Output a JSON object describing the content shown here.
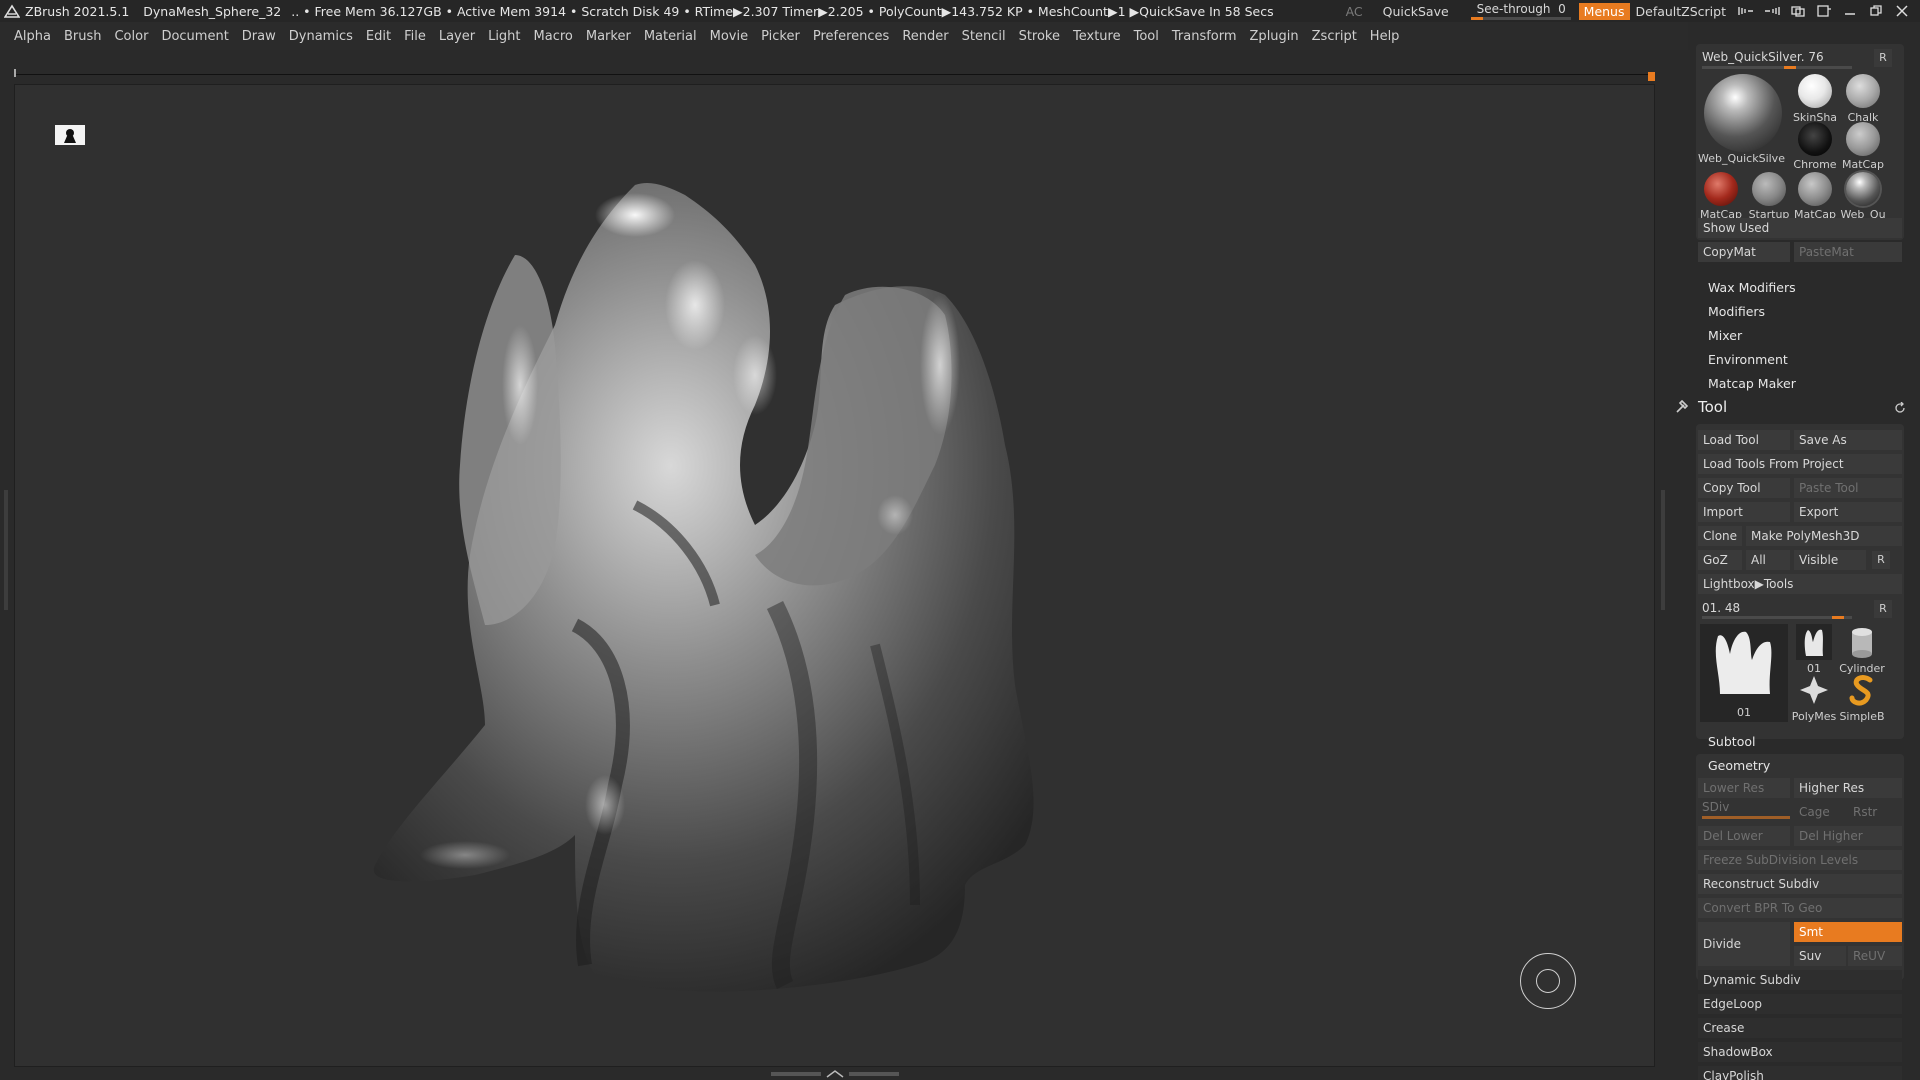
{
  "titlebar": {
    "app_title": "ZBrush 2021.5.1",
    "document": "DynaMesh_Sphere_32",
    "status": ".. • Free Mem 36.127GB • Active Mem 3914 • Scratch Disk 49 •  RTime▶2.307 Timer▶2.205 • PolyCount▶143.752 KP  • MeshCount▶1  ▶QuickSave In 58 Secs",
    "ac": "AC",
    "quicksave": "QuickSave",
    "see_through_label": "See-through",
    "see_through_value": "0",
    "menus": "Menus",
    "zscript": "DefaultZScript"
  },
  "menubar": [
    "Alpha",
    "Brush",
    "Color",
    "Document",
    "Draw",
    "Dynamics",
    "Edit",
    "File",
    "Layer",
    "Light",
    "Macro",
    "Marker",
    "Material",
    "Movie",
    "Picker",
    "Preferences",
    "Render",
    "Stencil",
    "Stroke",
    "Texture",
    "Tool",
    "Transform",
    "Zplugin",
    "Zscript",
    "Help"
  ],
  "material": {
    "current": "Web_QuickSilver. 76",
    "r": "R",
    "large_label": "Web_QuickSilver",
    "thumbs": [
      {
        "label": "SkinSha"
      },
      {
        "label": "Chalk"
      },
      {
        "label": "Chrome"
      },
      {
        "label": "MatCap"
      },
      {
        "label": "MatCap"
      },
      {
        "label": "Startup"
      },
      {
        "label": "MatCap"
      },
      {
        "label": "Web_Qu"
      }
    ],
    "show_used": "Show Used",
    "copy_mat": "CopyMat",
    "paste_mat": "PasteMat"
  },
  "sections": {
    "wax_modifiers": "Wax Modifiers",
    "modifiers": "Modifiers",
    "mixer": "Mixer",
    "environment": "Environment",
    "matcap_maker": "Matcap Maker"
  },
  "tool": {
    "title": "Tool",
    "load_tool": "Load Tool",
    "save_as": "Save As",
    "load_from_project": "Load Tools From Project",
    "copy_tool": "Copy Tool",
    "paste_tool": "Paste Tool",
    "import": "Import",
    "export": "Export",
    "clone": "Clone",
    "make_polymesh": "Make PolyMesh3D",
    "goz": "GoZ",
    "all": "All",
    "visible": "Visible",
    "r": "R",
    "lightbox": "Lightbox▶Tools",
    "slider_label": "01. 48",
    "slider_fraction": 0.94,
    "main_label": "01",
    "thumbs": [
      {
        "label": "01"
      },
      {
        "label": "Cylinder"
      },
      {
        "label": "PolyMes"
      },
      {
        "label": "SimpleB"
      }
    ]
  },
  "subtool": "Subtool",
  "geometry": {
    "title": "Geometry",
    "lower_res": "Lower Res",
    "higher_res": "Higher Res",
    "sdiv": "SDiv",
    "cage": "Cage",
    "rstr": "Rstr",
    "del_lower": "Del Lower",
    "del_higher": "Del Higher",
    "freeze": "Freeze SubDivision Levels",
    "reconstruct": "Reconstruct Subdiv",
    "convert_bpr": "Convert BPR To Geo",
    "divide": "Divide",
    "smt": "Smt",
    "suv": "Suv",
    "reuv": "ReUV"
  },
  "more_sections": [
    "Dynamic Subdiv",
    "EdgeLoop",
    "Crease",
    "ShadowBox",
    "ClayPolish"
  ],
  "colors": {
    "accent": "#e87b20",
    "background": "#2a2a2a",
    "canvas": "#303030"
  }
}
